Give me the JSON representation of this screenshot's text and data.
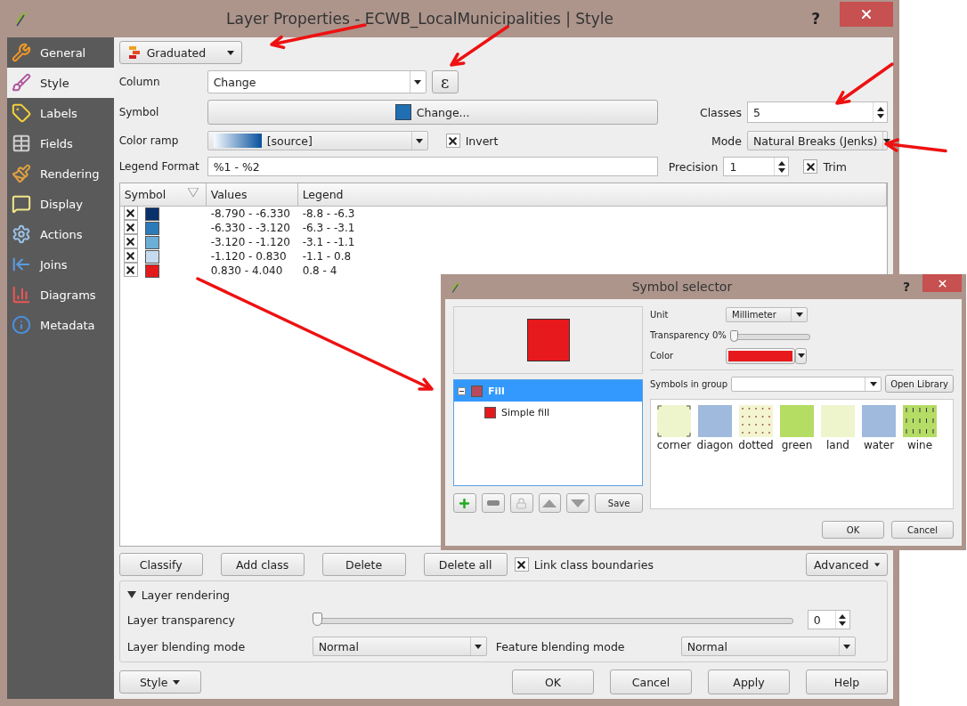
{
  "window": {
    "title": "Layer Properties - ECWB_LocalMunicipalities | Style",
    "help": "?"
  },
  "sidebar": {
    "items": [
      {
        "label": "General",
        "kind": "general",
        "selected": false
      },
      {
        "label": "Style",
        "kind": "style",
        "selected": true
      },
      {
        "label": "Labels",
        "kind": "labels",
        "selected": false
      },
      {
        "label": "Fields",
        "kind": "fields",
        "selected": false
      },
      {
        "label": "Rendering",
        "kind": "rendering",
        "selected": false
      },
      {
        "label": "Display",
        "kind": "display",
        "selected": false
      },
      {
        "label": "Actions",
        "kind": "actions",
        "selected": false
      },
      {
        "label": "Joins",
        "kind": "joins",
        "selected": false
      },
      {
        "label": "Diagrams",
        "kind": "diagrams",
        "selected": false
      },
      {
        "label": "Metadata",
        "kind": "metadata",
        "selected": false
      }
    ]
  },
  "renderer": {
    "value": "Graduated"
  },
  "column": {
    "label": "Column",
    "value": "Change",
    "expression": "ε"
  },
  "symbol": {
    "label": "Symbol",
    "button": "Change..."
  },
  "classes": {
    "label": "Classes",
    "value": "5"
  },
  "color_ramp": {
    "label": "Color ramp",
    "value": "[source]",
    "invert": {
      "label": "Invert",
      "checked": true
    }
  },
  "mode": {
    "label": "Mode",
    "value": "Natural Breaks (Jenks)"
  },
  "legend_format": {
    "label": "Legend Format",
    "value": "%1 - %2"
  },
  "precision": {
    "label": "Precision",
    "value": "1",
    "trim": {
      "label": "Trim",
      "checked": true
    }
  },
  "table": {
    "columns": [
      "Symbol",
      "Values",
      "Legend"
    ],
    "rows": [
      {
        "checked": true,
        "color": "#08306b",
        "values": "-8.790 - -6.330",
        "legend": "-8.8 - -6.3"
      },
      {
        "checked": true,
        "color": "#2b7bba",
        "values": "-6.330 - -3.120",
        "legend": "-6.3 - -3.1"
      },
      {
        "checked": true,
        "color": "#6baed6",
        "values": "-3.120 - -1.120",
        "legend": "-3.1 - -1.1"
      },
      {
        "checked": true,
        "color": "#c6dbef",
        "values": "-1.120 - 0.830",
        "legend": "-1.1 - 0.8"
      },
      {
        "checked": true,
        "color": "#e31a1c",
        "values": "0.830 - 4.040",
        "legend": "0.8 - 4"
      }
    ]
  },
  "actions": [
    "Classify",
    "Add class",
    "Delete",
    "Delete all"
  ],
  "link_boundaries": {
    "label": "Link class boundaries",
    "checked": true
  },
  "advanced": "Advanced",
  "layer_rendering": {
    "title": "Layer rendering",
    "expanded": true,
    "transparency": {
      "label": "Layer transparency",
      "level": 0,
      "value": "0"
    },
    "layer_blending": {
      "label": "Layer blending mode",
      "value": "Normal"
    },
    "feature_blending": {
      "label": "Feature blending mode",
      "value": "Normal"
    }
  },
  "footer": {
    "style": "Style",
    "buttons": [
      "OK",
      "Cancel",
      "Apply",
      "Help"
    ]
  },
  "symbol_selector": {
    "title": "Symbol selector",
    "help": "?",
    "layers": [
      {
        "label": "Fill",
        "selected": true,
        "expanded": true,
        "children": [
          {
            "label": "Simple fill",
            "selected": false
          }
        ]
      }
    ],
    "save": "Save",
    "unit": {
      "label": "Unit",
      "value": "Millimeter"
    },
    "transparency": {
      "label": "Transparency 0%",
      "level": 0
    },
    "color": {
      "label": "Color"
    },
    "symbols_in_group": {
      "label": "Symbols in group"
    },
    "open_library": "Open Library",
    "symbols": [
      {
        "label": "corner",
        "kind": "corners",
        "color": "#eef5cc"
      },
      {
        "label": "diagon",
        "kind": "plain",
        "color": "#9fbadc"
      },
      {
        "label": "dotted",
        "kind": "dotted",
        "color": "#f3f5d0"
      },
      {
        "label": "green",
        "kind": "plain",
        "color": "#b5dc63"
      },
      {
        "label": "land",
        "kind": "plain",
        "color": "#eef5cd"
      },
      {
        "label": "water",
        "kind": "plain",
        "color": "#9fbadd"
      },
      {
        "label": "wine",
        "kind": "lines",
        "color": "#b5dc64"
      }
    ],
    "buttons": [
      "OK",
      "Cancel"
    ]
  }
}
